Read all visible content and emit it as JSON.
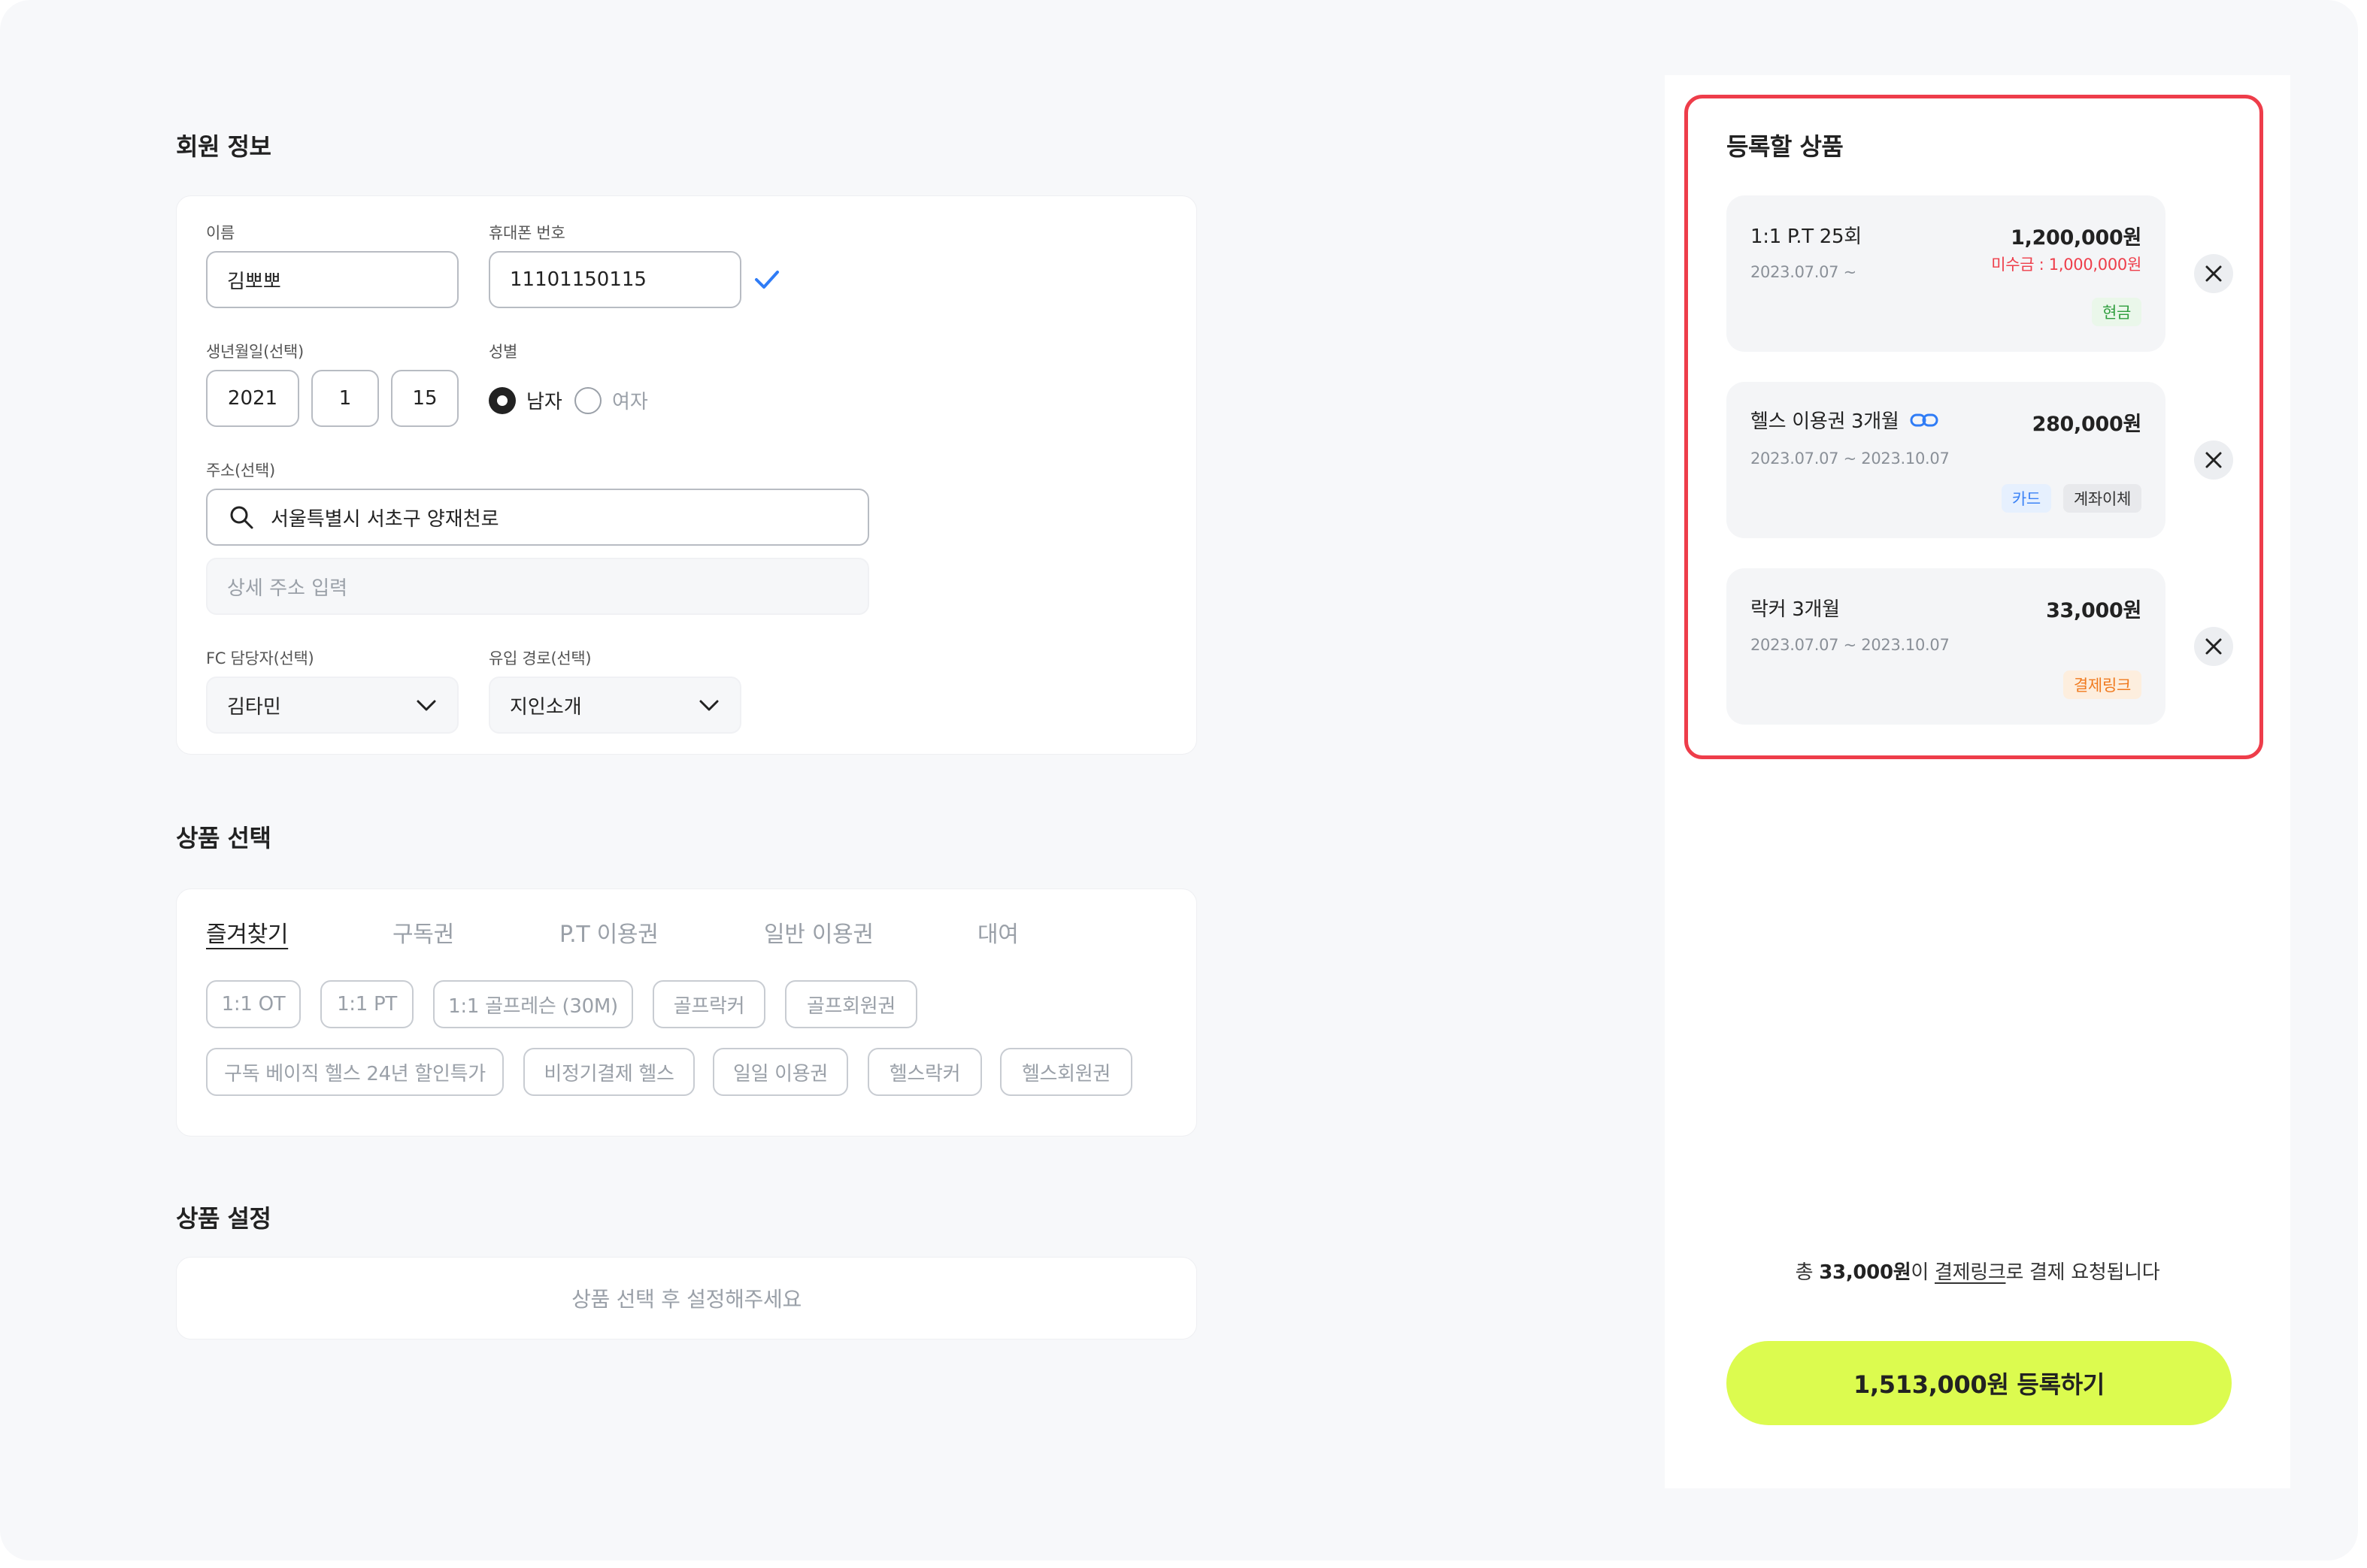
{
  "member": {
    "title": "회원 정보",
    "name_label": "이름",
    "name_value": "김뽀뽀",
    "phone_label": "휴대폰 번호",
    "phone_value": "11101150115",
    "birth_label": "생년월일(선택)",
    "birth_year": "2021",
    "birth_month": "1",
    "birth_day": "15",
    "gender_label": "성별",
    "gender_male": "남자",
    "gender_female": "여자",
    "address_label": "주소(선택)",
    "address_value": "서울특별시 서초구 양재천로",
    "address_detail_placeholder": "상세 주소 입력",
    "fc_label": "FC 담당자(선택)",
    "fc_value": "김타민",
    "source_label": "유입 경로(선택)",
    "source_value": "지인소개"
  },
  "product_select": {
    "title": "상품 선택",
    "tabs": [
      "즐겨찾기",
      "구독권",
      "P.T 이용권",
      "일반 이용권",
      "대여"
    ],
    "chips_row1": [
      "1:1 OT",
      "1:1 PT",
      "1:1 골프레슨 (30M)",
      "골프락커",
      "골프회원권"
    ],
    "chips_row2": [
      "구독 베이직 헬스 24년 할인특가",
      "비정기결제 헬스",
      "일일 이용권",
      "헬스락커",
      "헬스회원권"
    ]
  },
  "product_setting": {
    "title": "상품 설정",
    "empty_text": "상품 선택 후 설정해주세요"
  },
  "register": {
    "title": "등록할 상품",
    "items": [
      {
        "name": "1:1 P.T 25회",
        "price": "1,200,000원",
        "date": "2023.07.07 ~",
        "due": "미수금 : 1,000,000원",
        "badges": [
          "현금"
        ]
      },
      {
        "name": "헬스 이용권 3개월",
        "price": "280,000원",
        "date": "2023.07.07 ~ 2023.10.07",
        "badges": [
          "카드",
          "계좌이체"
        ]
      },
      {
        "name": "락커 3개월",
        "price": "33,000원",
        "date": "2023.07.07 ~ 2023.10.07",
        "badges": [
          "결제링크"
        ]
      }
    ],
    "summary_prefix": "총 ",
    "summary_amount": "33,000원",
    "summary_mid": "이 ",
    "summary_method": "결제링크",
    "summary_suffix": "로 결제 요청됩니다",
    "cta_label": "1,513,000원 등록하기"
  },
  "colors": {
    "accent_lime": "#dcfb4f",
    "highlight_red": "#ee3d4a",
    "check_blue": "#2f7cf6",
    "badge_cash": "#2e9e3e",
    "badge_card": "#3b82f6",
    "badge_link": "#f07a1f"
  }
}
